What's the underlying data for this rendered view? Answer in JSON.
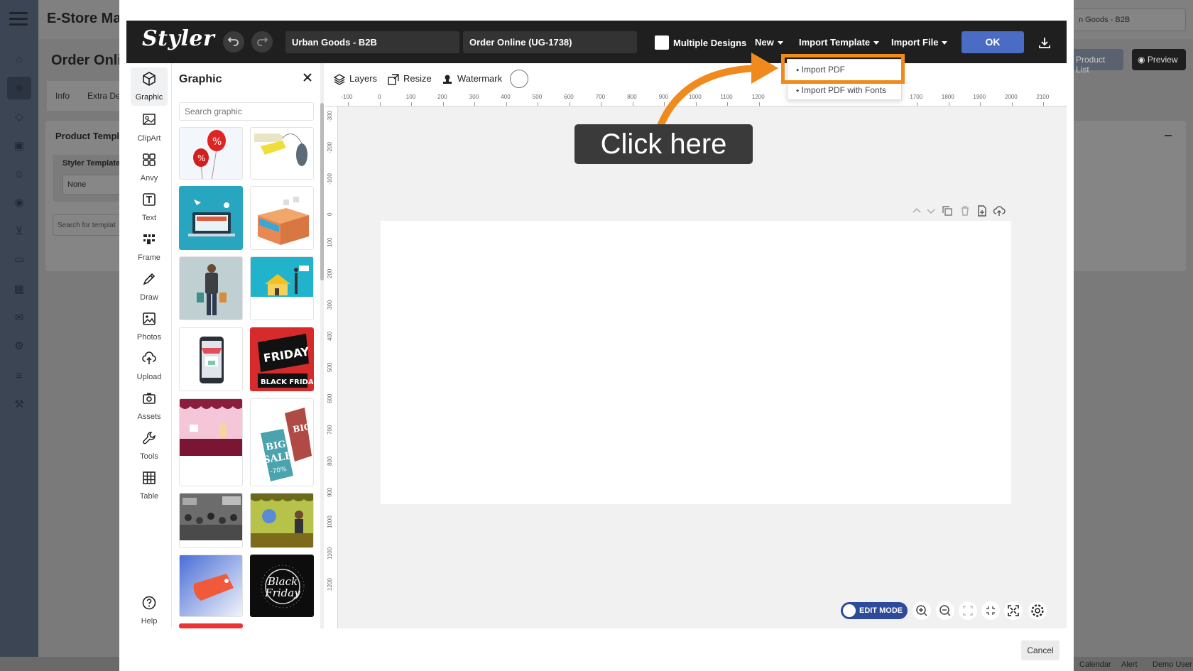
{
  "background_app": {
    "title": "E-Store Mar",
    "page_title": "Order Onli",
    "store_selector": "n Goods - B2B",
    "tabs": [
      "Info",
      "Extra De"
    ],
    "card_title": "Product Templa",
    "styler_template_label": "Styler Template",
    "styler_template_value": "None",
    "search_templates_placeholder": "Search for templat",
    "product_list_button": "Product List",
    "preview_button": "Preview",
    "footer_items": [
      "Calendar",
      "Alert",
      "Demo User"
    ]
  },
  "editor": {
    "logo": "Styler",
    "store_field": "Urban Goods - B2B",
    "product_field": "Order Online (UG-1738)",
    "multiple_designs_label": "Multiple Designs",
    "menus": {
      "new": "New",
      "import_template": "Import Template",
      "import_file": "Import File"
    },
    "ok_label": "OK",
    "cancel_label": "Cancel"
  },
  "rail": [
    {
      "label": "Graphic",
      "icon": "cube-icon"
    },
    {
      "label": "ClipArt",
      "icon": "clipart-icon"
    },
    {
      "label": "Anvy",
      "icon": "grid-icon"
    },
    {
      "label": "Text",
      "icon": "text-icon"
    },
    {
      "label": "Frame",
      "icon": "frame-icon"
    },
    {
      "label": "Draw",
      "icon": "pencil-icon"
    },
    {
      "label": "Photos",
      "icon": "image-icon"
    },
    {
      "label": "Upload",
      "icon": "upload-icon"
    },
    {
      "label": "Assets",
      "icon": "camera-icon"
    },
    {
      "label": "Tools",
      "icon": "wrench-icon"
    },
    {
      "label": "Table",
      "icon": "table-icon"
    },
    {
      "label": "Help",
      "icon": "help-icon"
    }
  ],
  "graphic_panel": {
    "title": "Graphic",
    "search_placeholder": "Search graphic",
    "thumb_texts": {
      "friday": "FRIDAY",
      "black_friday": "BLACK FRIDAY",
      "big": "BIG",
      "sale": "SALE",
      "pct": "-70%",
      "black": "Black",
      "friday_script": "Friday"
    }
  },
  "canvas_toolbar": {
    "layers": "Layers",
    "resize": "Resize",
    "watermark": "Watermark"
  },
  "ruler": {
    "h": [
      "-100",
      "0",
      "100",
      "200",
      "300",
      "400",
      "500",
      "600",
      "700",
      "800",
      "900",
      "1000",
      "1100",
      "1200",
      "1700",
      "1800",
      "1900",
      "2000",
      "2100"
    ],
    "v": [
      "-300",
      "-200",
      "-100",
      "0",
      "100",
      "200",
      "300",
      "400",
      "500",
      "600",
      "700",
      "800",
      "900",
      "1000",
      "1100",
      "1200"
    ]
  },
  "controls": {
    "edit_mode": "EDIT MODE"
  },
  "import_template_menu": {
    "items": [
      "Import PDF",
      "Import PDF with Fonts"
    ],
    "highlighted": "Import PDF"
  },
  "callout": {
    "text": "Click here"
  },
  "colors": {
    "accent_orange": "#f08a1d",
    "ok_blue": "#4a6cc4",
    "topbar": "#1f1f1f",
    "edit_mode_blue": "#2d4b9a"
  }
}
